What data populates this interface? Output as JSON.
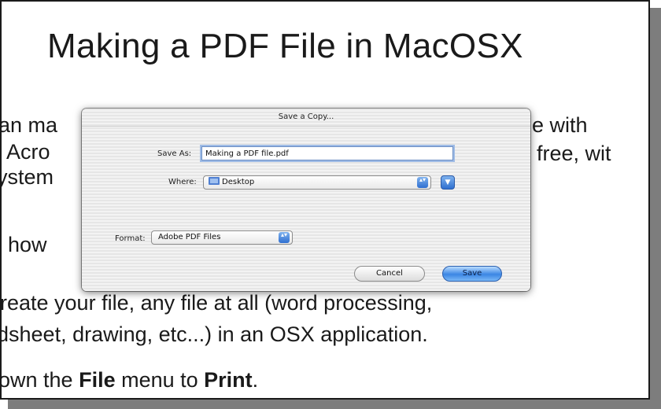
{
  "slide": {
    "title": "Making a PDF File in MacOSX",
    "lines": [
      {
        "pre": "an ma",
        "tail": "le with"
      },
      {
        "pre": " Acro",
        "tail": "free, wit"
      },
      {
        "pre": "ystem",
        "tail": ""
      },
      {
        "pre": " how",
        "tail": ""
      },
      {
        "text": "reate your file, any file at all (word processing,"
      },
      {
        "text": "dsheet, drawing, etc...) in an OSX application."
      },
      {
        "pre": "own the ",
        "b1": "File",
        "mid": " menu to ",
        "b2": "Print",
        "post": "."
      }
    ]
  },
  "dialog": {
    "title": "Save a Copy...",
    "save_as_label": "Save As:",
    "save_as_value": "Making a PDF file.pdf",
    "where_label": "Where:",
    "where_value": "Desktop",
    "format_label": "Format:",
    "format_value": "Adobe PDF Files",
    "popup_arrows": "▴▾",
    "disclosure_glyph": "▼",
    "cancel_label": "Cancel",
    "save_label": "Save"
  }
}
